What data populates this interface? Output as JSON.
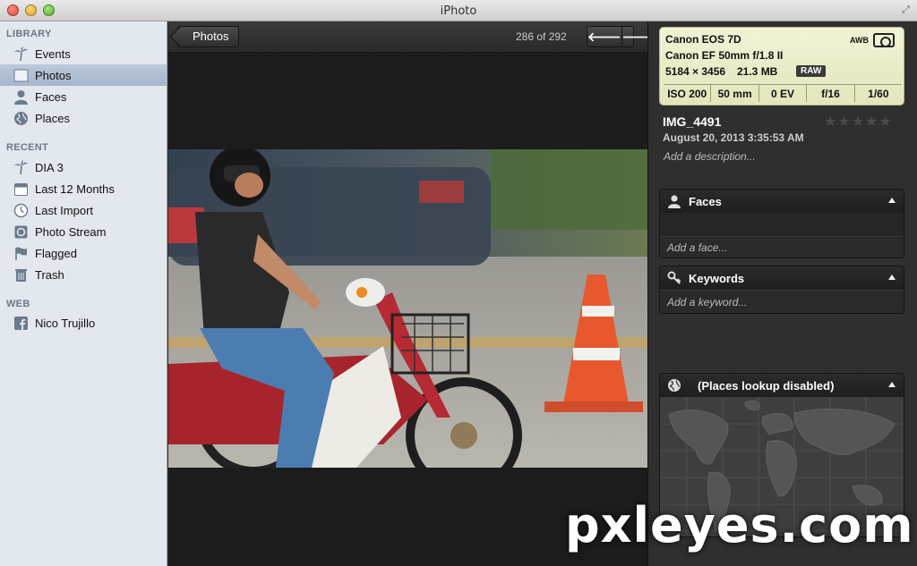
{
  "window": {
    "title": "iPhoto"
  },
  "sidebar": {
    "library_header": "LIBRARY",
    "library": [
      {
        "label": "Events",
        "icon": "palm-tree-icon"
      },
      {
        "label": "Photos",
        "icon": "photos-icon",
        "selected": true
      },
      {
        "label": "Faces",
        "icon": "person-icon"
      },
      {
        "label": "Places",
        "icon": "globe-icon"
      }
    ],
    "recent_header": "RECENT",
    "recent": [
      {
        "label": "DIA 3",
        "icon": "palm-tree-icon"
      },
      {
        "label": "Last 12 Months",
        "icon": "calendar-icon"
      },
      {
        "label": "Last Import",
        "icon": "clock-icon"
      },
      {
        "label": "Photo Stream",
        "icon": "photo-stream-icon"
      },
      {
        "label": "Flagged",
        "icon": "flag-icon"
      },
      {
        "label": "Trash",
        "icon": "trash-icon"
      }
    ],
    "web_header": "WEB",
    "web": [
      {
        "label": "Nico Trujillo",
        "icon": "facebook-icon"
      }
    ]
  },
  "viewer": {
    "back_label": "Photos",
    "counter": "286 of 292",
    "prev_symbol": "🡐",
    "next_symbol": "🡒"
  },
  "info": {
    "exif": {
      "camera": "Canon EOS 7D",
      "lens": "Canon EF 50mm f/1.8 II",
      "dimensions": "5184 × 3456",
      "size": "21.3 MB",
      "format": "RAW",
      "white_balance": "AWB",
      "iso": "ISO 200",
      "focal": "50 mm",
      "exposure_bias": "0 EV",
      "aperture": "f/16",
      "shutter": "1/60"
    },
    "name": "IMG_4491",
    "date": "August 20, 2013 3:35:53 AM",
    "rating": 0,
    "stars": "★★★★★",
    "description_placeholder": "Add a description...",
    "faces": {
      "title": "Faces",
      "placeholder": "Add a face..."
    },
    "keywords": {
      "title": "Keywords",
      "placeholder": "Add a keyword..."
    },
    "places": {
      "title": "(Places lookup disabled)"
    }
  },
  "watermark": "pxleyes.com",
  "colors": {
    "sidebar_bg": "#e3e7ee",
    "sidebar_selected": "#b0bdd2",
    "viewer_bg": "#1c1c1c",
    "exif_bg": "#eef0cd"
  }
}
